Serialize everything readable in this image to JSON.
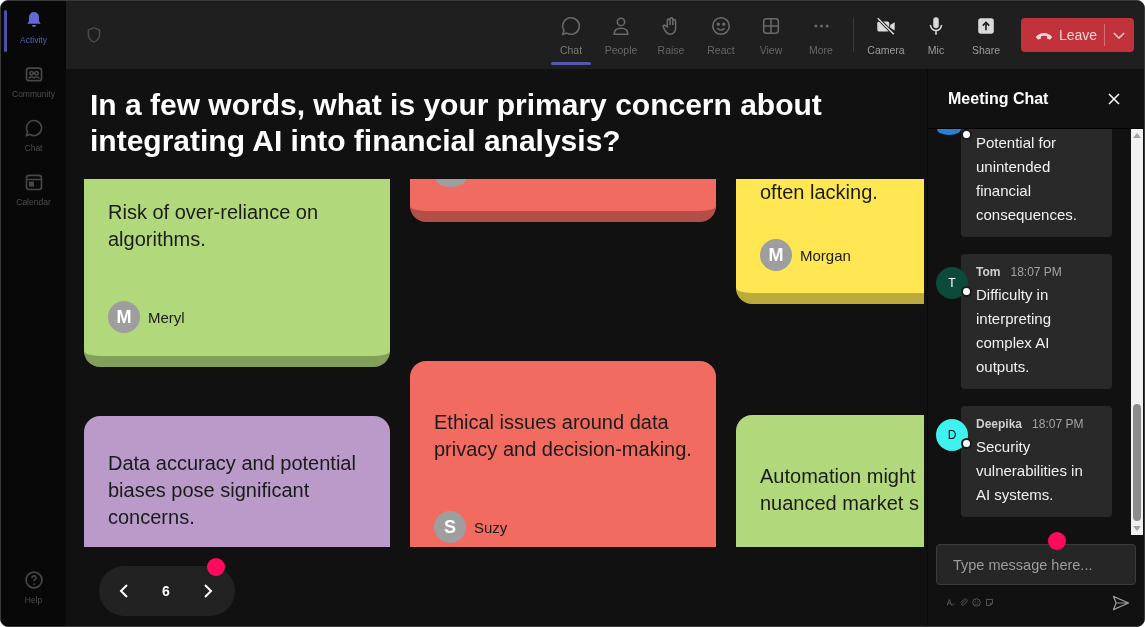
{
  "sidebar": {
    "items": [
      {
        "label": "Activity",
        "selected": true
      },
      {
        "label": "Community",
        "selected": false
      },
      {
        "label": "Chat",
        "selected": false
      },
      {
        "label": "Calendar",
        "selected": false
      }
    ],
    "bottom_items": [
      {
        "label": "Help",
        "selected": false
      }
    ]
  },
  "toolbar": {
    "items": [
      {
        "label": "Chat",
        "selected": true
      },
      {
        "label": "People",
        "selected": false
      },
      {
        "label": "Raise",
        "selected": false
      },
      {
        "label": "React",
        "selected": false
      },
      {
        "label": "View",
        "selected": false
      },
      {
        "label": "More",
        "selected": false
      }
    ],
    "device_items": [
      {
        "label": "Camera",
        "on": false
      },
      {
        "label": "Mic",
        "on": true
      },
      {
        "label": "Share"
      }
    ],
    "leave_button": {
      "label": "Leave"
    }
  },
  "question": "In a few words, what is your primary concern about integrating AI into financial analysis?",
  "board": {
    "columns": [
      {
        "cards": [
          {
            "color": "#b1d87b",
            "text": "Risk of over-reliance on algorithms.",
            "author": {
              "initial": "M",
              "name": "Meryl"
            }
          },
          {
            "color": "#b99ac9",
            "text": "Data accuracy and potential biases pose significant concerns."
          }
        ]
      },
      {
        "cards": [
          {
            "color": "#f26b61"
          },
          {
            "color": "#f26b61",
            "text": "Ethical issues around data privacy and decision-making.",
            "author": {
              "initial": "S",
              "name": "Suzy"
            }
          }
        ]
      },
      {
        "cards": [
          {
            "color": "#ffe653",
            "text": "often lacking.",
            "author": {
              "initial": "M",
              "name": "Morgan"
            }
          },
          {
            "color": "#b1d87b",
            "text": "Automation might\nnuanced market s"
          }
        ]
      }
    ]
  },
  "pager": {
    "page": "6"
  },
  "chat": {
    "title": "Meeting Chat",
    "messages": [
      {
        "color": "#2a7fd4",
        "text": "Potential for unintended financial consequences."
      },
      {
        "author": "Tom",
        "initial": "T",
        "time": "18:07 PM",
        "color": "#0c4a3a",
        "text": "Difficulty in interpreting complex AI outputs."
      },
      {
        "author": "Deepika",
        "initial": "D",
        "time": "18:07 PM",
        "color": "#3ef2ef",
        "text": "Security vulnerabilities in AI systems."
      }
    ],
    "composer": {
      "placeholder": "Type message here..."
    }
  }
}
